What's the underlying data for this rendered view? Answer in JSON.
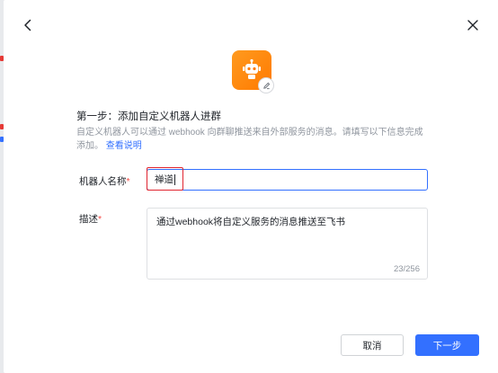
{
  "dialog": {
    "step_title": "第一步：添加自定义机器人进群",
    "step_description": "自定义机器人可以通过 webhook 向群聊推送来自外部服务的消息。请填写以下信息完成添加。",
    "doc_link": "查看说明"
  },
  "form": {
    "name_label": "机器人名称",
    "name_value": "禅道",
    "description_label": "描述",
    "required_mark": "*",
    "description_value": "通过webhook将自定义服务的消息推送至飞书",
    "char_count": "23/256"
  },
  "buttons": {
    "cancel": "取消",
    "next": "下一步"
  },
  "icons": {
    "back": "chevron-left-icon",
    "close": "close-icon",
    "avatar": "robot-icon",
    "edit": "pencil-icon"
  },
  "colors": {
    "accent": "#3370ff",
    "avatar": "#ff7a00",
    "highlight": "#e0242f",
    "required": "#f54a45"
  }
}
